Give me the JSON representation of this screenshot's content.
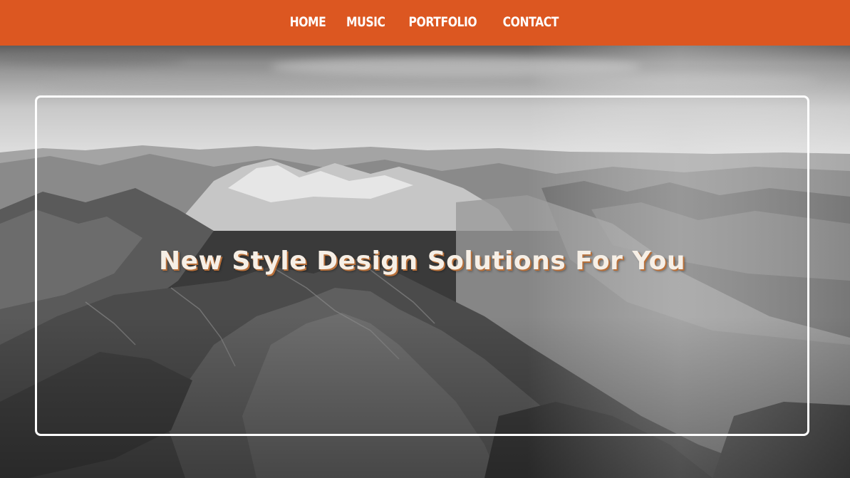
{
  "colors": {
    "nav_background": "#dc5721",
    "nav_text": "#ffffff",
    "frame_border": "#ffffff",
    "headline_text": "#f6efe6",
    "headline_shadow": "#b8703a"
  },
  "nav": {
    "items": [
      {
        "label": "HOME"
      },
      {
        "label": "MUSIC"
      },
      {
        "label": "PORTFOLIO"
      },
      {
        "label": "CONTACT"
      }
    ]
  },
  "hero": {
    "background": "grayscale mountain range aerial photo",
    "headline": "New Style Design Solutions For You"
  }
}
